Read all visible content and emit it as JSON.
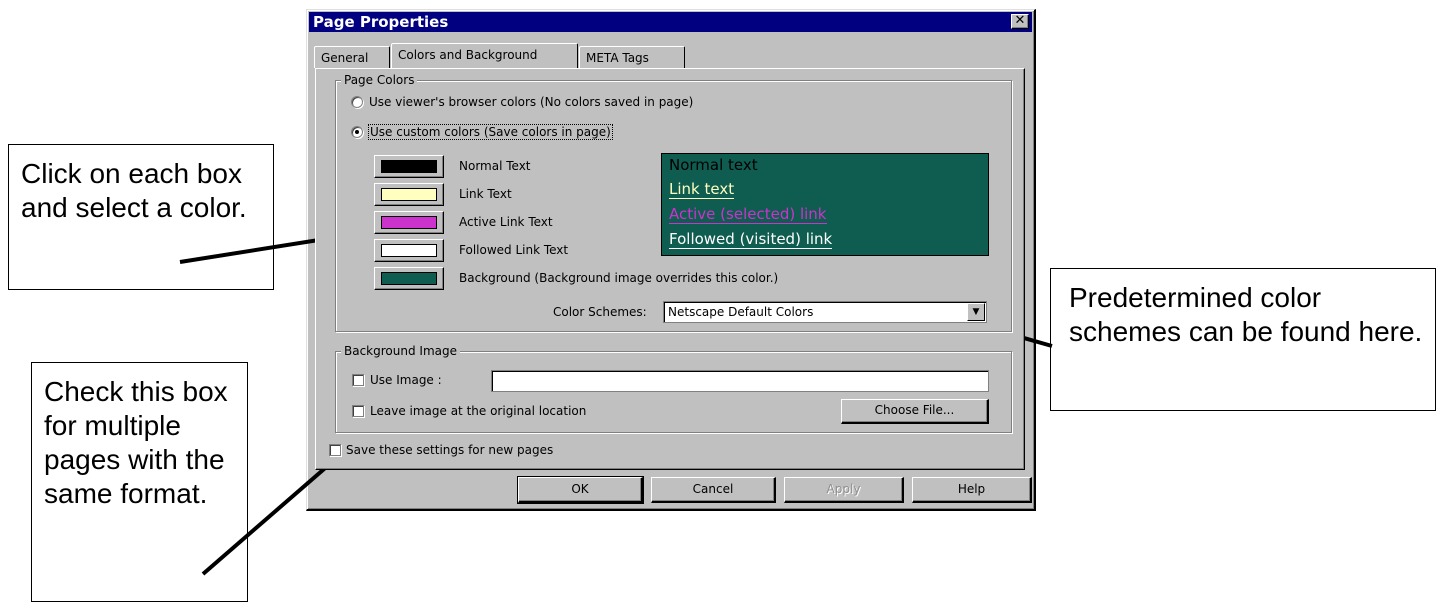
{
  "callouts": {
    "left_top": "Click on each box and select a color.",
    "left_bottom": "Check this box for multiple pages with the same format.",
    "right": "Predetermined color schemes can be found here."
  },
  "dialog": {
    "title": "Page Properties",
    "close_glyph": "✕",
    "tabs": [
      {
        "label": "General"
      },
      {
        "label": "Colors and Background"
      },
      {
        "label": "META Tags"
      }
    ],
    "page_colors": {
      "legend": "Page Colors",
      "radio_browser": "Use viewer's browser colors (No colors saved in page)",
      "radio_custom": "Use custom colors (Save colors in page)",
      "selected": "custom",
      "colors": [
        {
          "label": "Normal Text",
          "color": "#000000"
        },
        {
          "label": "Link Text",
          "color": "#ffffc0"
        },
        {
          "label": "Active Link Text",
          "color": "#cc33cc"
        },
        {
          "label": "Followed Link Text",
          "color": "#ffffff"
        },
        {
          "label": "Background (Background image overrides this color.)",
          "color": "#0f5c50"
        }
      ],
      "preview": {
        "normal": "Normal text",
        "link": "Link text",
        "active": "Active (selected) link",
        "followed": "Followed (visited) link",
        "bg": "#0f5c50",
        "normal_color": "#000000",
        "link_color": "#ffffc0",
        "active_color": "#cc33cc",
        "followed_color": "#ffffff"
      },
      "schemes_label": "Color Schemes:",
      "schemes_value": "Netscape Default Colors",
      "dropdown_glyph": "▼"
    },
    "background_image": {
      "legend": "Background Image",
      "use_image": "Use Image :",
      "use_image_value": "",
      "leave_original": "Leave image at the original location",
      "choose_file": "Choose File..."
    },
    "save_settings": "Save these settings for new pages",
    "buttons": {
      "ok": "OK",
      "cancel": "Cancel",
      "apply": "Apply",
      "help": "Help"
    }
  }
}
